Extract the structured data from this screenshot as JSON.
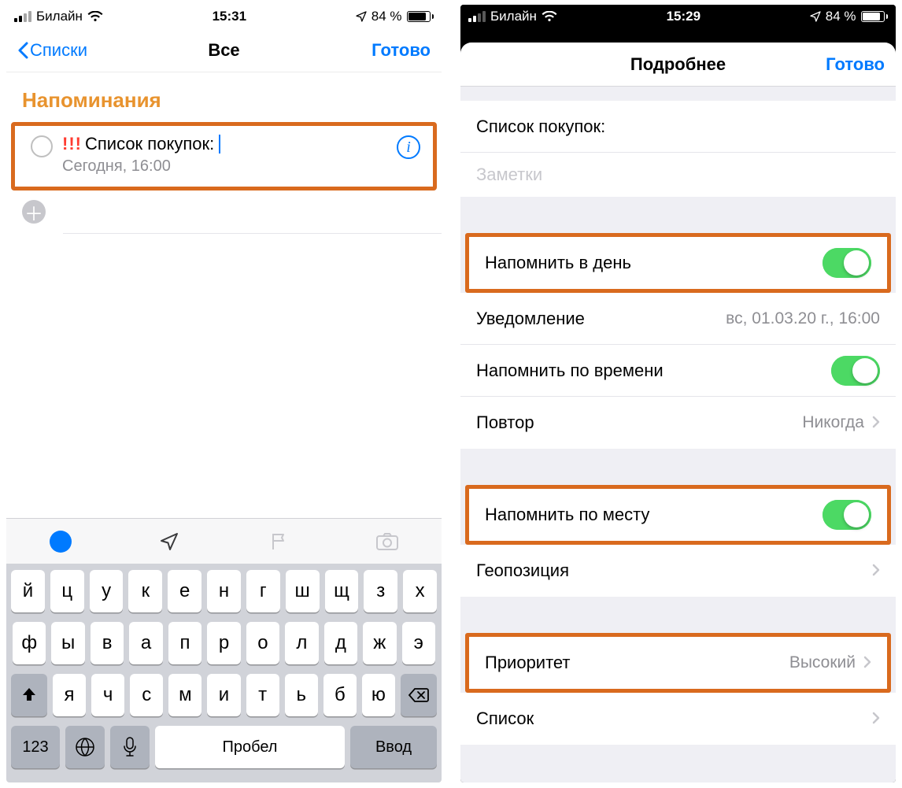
{
  "left": {
    "status": {
      "carrier": "Билайн",
      "time": "15:31",
      "battery": "84 %"
    },
    "nav": {
      "back": "Списки",
      "title": "Все",
      "done": "Готово"
    },
    "section_title": "Напоминания",
    "reminder": {
      "priority_marks": "!!!",
      "title": "Список покупок:",
      "subtitle": "Сегодня, 16:00"
    },
    "keyboard": {
      "row1": [
        "й",
        "ц",
        "у",
        "к",
        "е",
        "н",
        "г",
        "ш",
        "щ",
        "з",
        "х"
      ],
      "row2": [
        "ф",
        "ы",
        "в",
        "а",
        "п",
        "р",
        "о",
        "л",
        "д",
        "ж",
        "э"
      ],
      "row3": [
        "я",
        "ч",
        "с",
        "м",
        "и",
        "т",
        "ь",
        "б",
        "ю"
      ],
      "numKey": "123",
      "space": "Пробел",
      "enter": "Ввод"
    }
  },
  "right": {
    "status": {
      "carrier": "Билайн",
      "time": "15:29",
      "battery": "84 %"
    },
    "nav": {
      "title": "Подробнее",
      "done": "Готово"
    },
    "title_field": "Список покупок:",
    "notes_placeholder": "Заметки",
    "rows": {
      "remind_day": "Напомнить в день",
      "alert_label": "Уведомление",
      "alert_value": "вс, 01.03.20 г., 16:00",
      "remind_time": "Напомнить по времени",
      "repeat_label": "Повтор",
      "repeat_value": "Никогда",
      "remind_location": "Напомнить по месту",
      "location_label": "Геопозиция",
      "priority_label": "Приоритет",
      "priority_value": "Высокий",
      "list_label": "Список"
    }
  }
}
